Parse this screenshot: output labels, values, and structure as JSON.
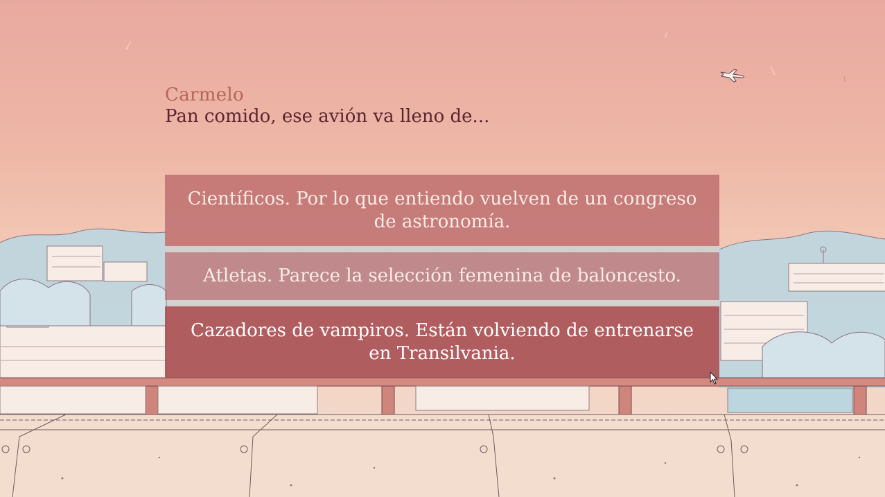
{
  "dialogue": {
    "speaker": "Carmelo",
    "line": "Pan comido, ese avión va lleno de..."
  },
  "choices": [
    {
      "label": "Científicos. Por lo que entiendo vuelven de un congreso de astronomía.",
      "highlighted": false
    },
    {
      "label": "Atletas. Parece la selección femenina de baloncesto.",
      "highlighted": false
    },
    {
      "label": "Cazadores de vampiros. Están volviendo de entrenarse en Transilvania.",
      "highlighted": true
    }
  ],
  "scene": {
    "icons": [
      "airplane-icon",
      "mouse-cursor-icon"
    ],
    "colors": {
      "sky_top": "#e9a9a0",
      "sky_bottom": "#f2dccf",
      "hills": "#bcd6e0",
      "rail": "#c97f74",
      "ground": "#f3ddcf",
      "choice_bg": "#ba686a",
      "choice_selected_bg": "#ab4c50",
      "speaker_color": "#b46658",
      "text_color": "#5a2530"
    }
  }
}
